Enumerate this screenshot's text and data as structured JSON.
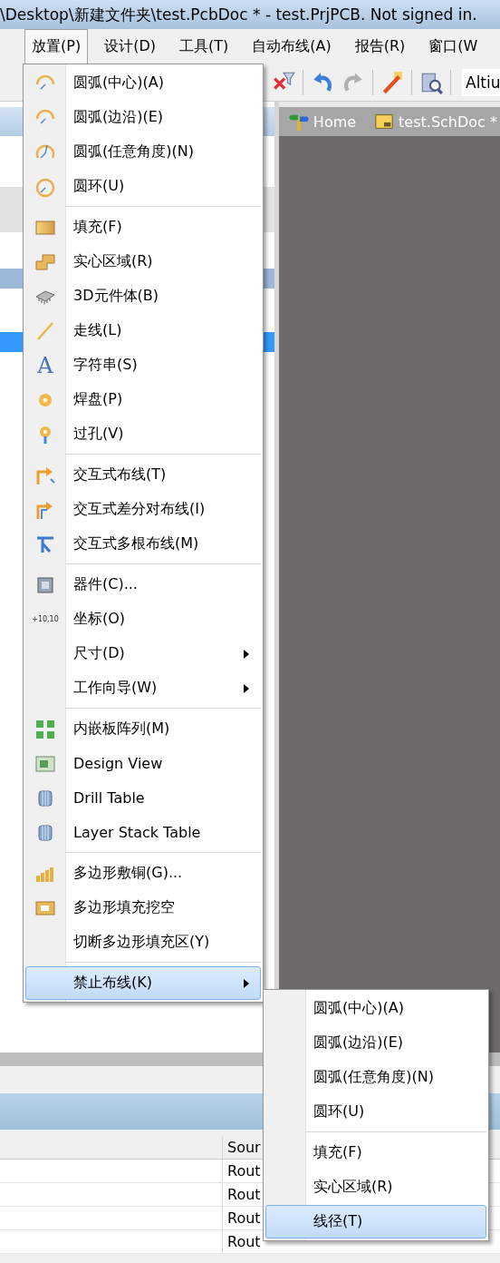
{
  "title_bar": {
    "title": "\\Desktop\\新建文件夹\\test.PcbDoc * - test.PrjPCB. Not signed in."
  },
  "menu_bar": [
    {
      "label": "放置(P)",
      "selected": true
    },
    {
      "label": "设计(D)",
      "selected": false
    },
    {
      "label": "工具(T)",
      "selected": false
    },
    {
      "label": "自动布线(A)",
      "selected": false
    },
    {
      "label": "报告(R)",
      "selected": false
    },
    {
      "label": "窗口(W",
      "selected": false
    }
  ],
  "toolbar": {
    "search_value": "Altiu"
  },
  "document_tabs": [
    {
      "label": "Home",
      "selected": false
    },
    {
      "label": "test.SchDoc *",
      "selected": false
    }
  ],
  "place_menu": {
    "items": [
      {
        "kind": "item",
        "label": "圆弧(中心)(A)",
        "has_submenu": false,
        "selected": false
      },
      {
        "kind": "item",
        "label": "圆弧(边沿)(E)",
        "has_submenu": false,
        "selected": false
      },
      {
        "kind": "item",
        "label": "圆弧(任意角度)(N)",
        "has_submenu": false,
        "selected": false
      },
      {
        "kind": "item",
        "label": "圆环(U)",
        "has_submenu": false,
        "selected": false
      },
      {
        "kind": "separator"
      },
      {
        "kind": "item",
        "label": "填充(F)",
        "has_submenu": false,
        "selected": false
      },
      {
        "kind": "item",
        "label": "实心区域(R)",
        "has_submenu": false,
        "selected": false
      },
      {
        "kind": "item",
        "label": "3D元件体(B)",
        "has_submenu": false,
        "selected": false
      },
      {
        "kind": "item",
        "label": "走线(L)",
        "has_submenu": false,
        "selected": false
      },
      {
        "kind": "item",
        "label": "字符串(S)",
        "icon_text": "A",
        "has_submenu": false,
        "selected": false
      },
      {
        "kind": "item",
        "label": "焊盘(P)",
        "has_submenu": false,
        "selected": false
      },
      {
        "kind": "item",
        "label": "过孔(V)",
        "has_submenu": false,
        "selected": false
      },
      {
        "kind": "separator"
      },
      {
        "kind": "item",
        "label": "交互式布线(T)",
        "has_submenu": false,
        "selected": false
      },
      {
        "kind": "item",
        "label": "交互式差分对布线(I)",
        "has_submenu": false,
        "selected": false
      },
      {
        "kind": "item",
        "label": "交互式多根布线(M)",
        "has_submenu": false,
        "selected": false
      },
      {
        "kind": "separator"
      },
      {
        "kind": "item",
        "label": "器件(C)...",
        "has_submenu": false,
        "selected": false
      },
      {
        "kind": "item",
        "label": "坐标(O)",
        "icon_text": "+10,10",
        "has_submenu": false,
        "selected": false
      },
      {
        "kind": "item",
        "label": "尺寸(D)",
        "has_submenu": true,
        "selected": false
      },
      {
        "kind": "item",
        "label": "工作向导(W)",
        "has_submenu": true,
        "selected": false
      },
      {
        "kind": "separator"
      },
      {
        "kind": "item",
        "label": "内嵌板阵列(M)",
        "has_submenu": false,
        "selected": false
      },
      {
        "kind": "item",
        "label": "Design View",
        "has_submenu": false,
        "selected": false
      },
      {
        "kind": "item",
        "label": "Drill Table",
        "has_submenu": false,
        "selected": false
      },
      {
        "kind": "item",
        "label": "Layer Stack Table",
        "has_submenu": false,
        "selected": false
      },
      {
        "kind": "separator"
      },
      {
        "kind": "item",
        "label": "多边形敷铜(G)...",
        "has_submenu": false,
        "selected": false
      },
      {
        "kind": "item",
        "label": "多边形填充挖空",
        "has_submenu": false,
        "selected": false
      },
      {
        "kind": "item",
        "label": "切断多边形填充区(Y)",
        "has_submenu": false,
        "selected": false
      },
      {
        "kind": "separator"
      },
      {
        "kind": "item",
        "label": "禁止布线(K)",
        "has_submenu": true,
        "selected": true
      }
    ]
  },
  "keepout_submenu": {
    "items": [
      {
        "kind": "item",
        "label": "圆弧(中心)(A)",
        "selected": false
      },
      {
        "kind": "item",
        "label": "圆弧(边沿)(E)",
        "selected": false
      },
      {
        "kind": "item",
        "label": "圆弧(任意角度)(N)",
        "selected": false
      },
      {
        "kind": "item",
        "label": "圆环(U)",
        "selected": false
      },
      {
        "kind": "separator"
      },
      {
        "kind": "item",
        "label": "填充(F)",
        "selected": false
      },
      {
        "kind": "item",
        "label": "实心区域(R)",
        "selected": false
      },
      {
        "kind": "item",
        "label": "线径(T)",
        "selected": true
      }
    ]
  },
  "messages_table": {
    "columns": [
      "Sour"
    ],
    "rows": [
      [
        "Rout"
      ],
      [
        "Rout"
      ],
      [
        "Rout"
      ],
      [
        "Rout"
      ]
    ]
  }
}
